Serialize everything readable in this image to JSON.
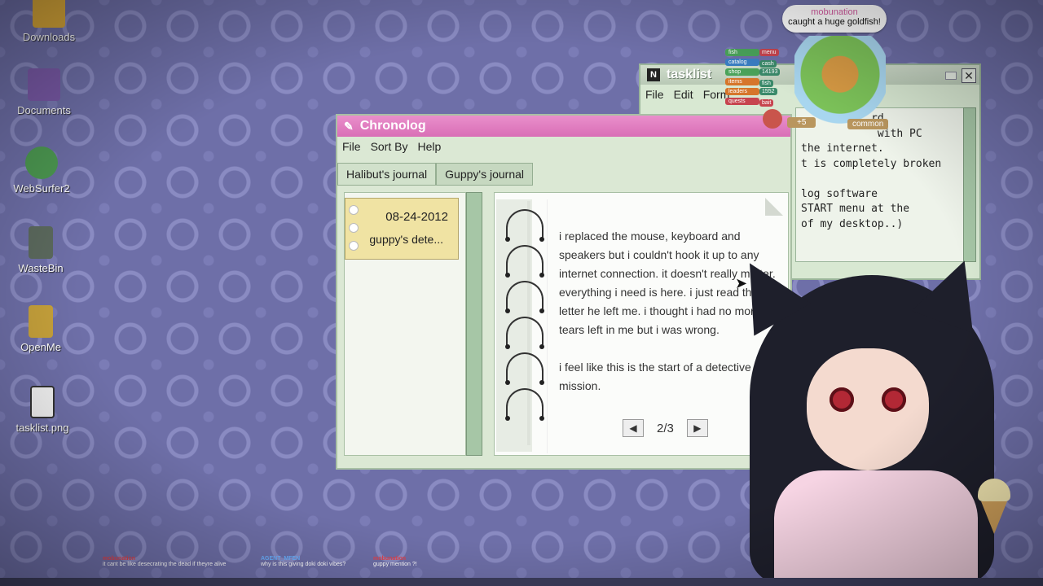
{
  "desktop_icons": [
    {
      "label": "Downloads",
      "icon": "folder-icon"
    },
    {
      "label": "Documents",
      "icon": "folder-icon"
    },
    {
      "label": "WebSurfer2",
      "icon": "globe-icon"
    },
    {
      "label": "WasteBin",
      "icon": "trash-icon"
    },
    {
      "label": "OpenMe",
      "icon": "trophy-icon"
    },
    {
      "label": "tasklist.png",
      "icon": "notepad-icon"
    }
  ],
  "tasklist": {
    "title": "tasklist",
    "menu": [
      "File",
      "Edit",
      "Form"
    ],
    "body_lines": [
      "           rd",
      "            with PC",
      "the internet.",
      "t is completely broken",
      "",
      "log software",
      "START menu at the",
      "of my desktop..)"
    ]
  },
  "chronolog": {
    "title": "Chronolog",
    "menu": [
      "File",
      "Sort By",
      "Help"
    ],
    "tabs": [
      "Halibut's journal",
      "Guppy's journal"
    ],
    "entry": {
      "date": "08-24-2012",
      "name": "guppy's dete..."
    },
    "page_paragraphs": [
      "i replaced the mouse, keyboard and speakers but i couldn't hook it up to any internet connection. it doesn't really matter. everything i need is here. i just read the letter he left me. i thought i had no more tears left in me but i was wrong.",
      "i feel like this is the start of a detective mission."
    ],
    "page_indicator": "2/3"
  },
  "overlay": {
    "bubble_user": "mobunation",
    "bubble_message": "caught a huge goldfish!",
    "menu_items": [
      {
        "label": "fish",
        "color": "#4aa35a"
      },
      {
        "label": "catalog",
        "color": "#3b7fc4"
      },
      {
        "label": "shop",
        "color": "#4aa35a"
      },
      {
        "label": "items",
        "color": "#d6762b"
      },
      {
        "label": "leaders",
        "color": "#d6762b"
      },
      {
        "label": "quests",
        "color": "#c7444f"
      }
    ],
    "stats": [
      "menu",
      "cash",
      "14193",
      "fish",
      "1552",
      "bait"
    ],
    "reward": "+5",
    "rarity": "common"
  },
  "chat": [
    {
      "user": "mobunation",
      "message": "it cant be like desecrating the dead if theyre alive",
      "user_color": "red"
    },
    {
      "user": "AGENT_MFEN",
      "message": "why is this giving doki doki vibes?",
      "user_color": "blue"
    },
    {
      "user": "mobunation",
      "message": "guppy mention ?!",
      "user_color": "red"
    }
  ]
}
